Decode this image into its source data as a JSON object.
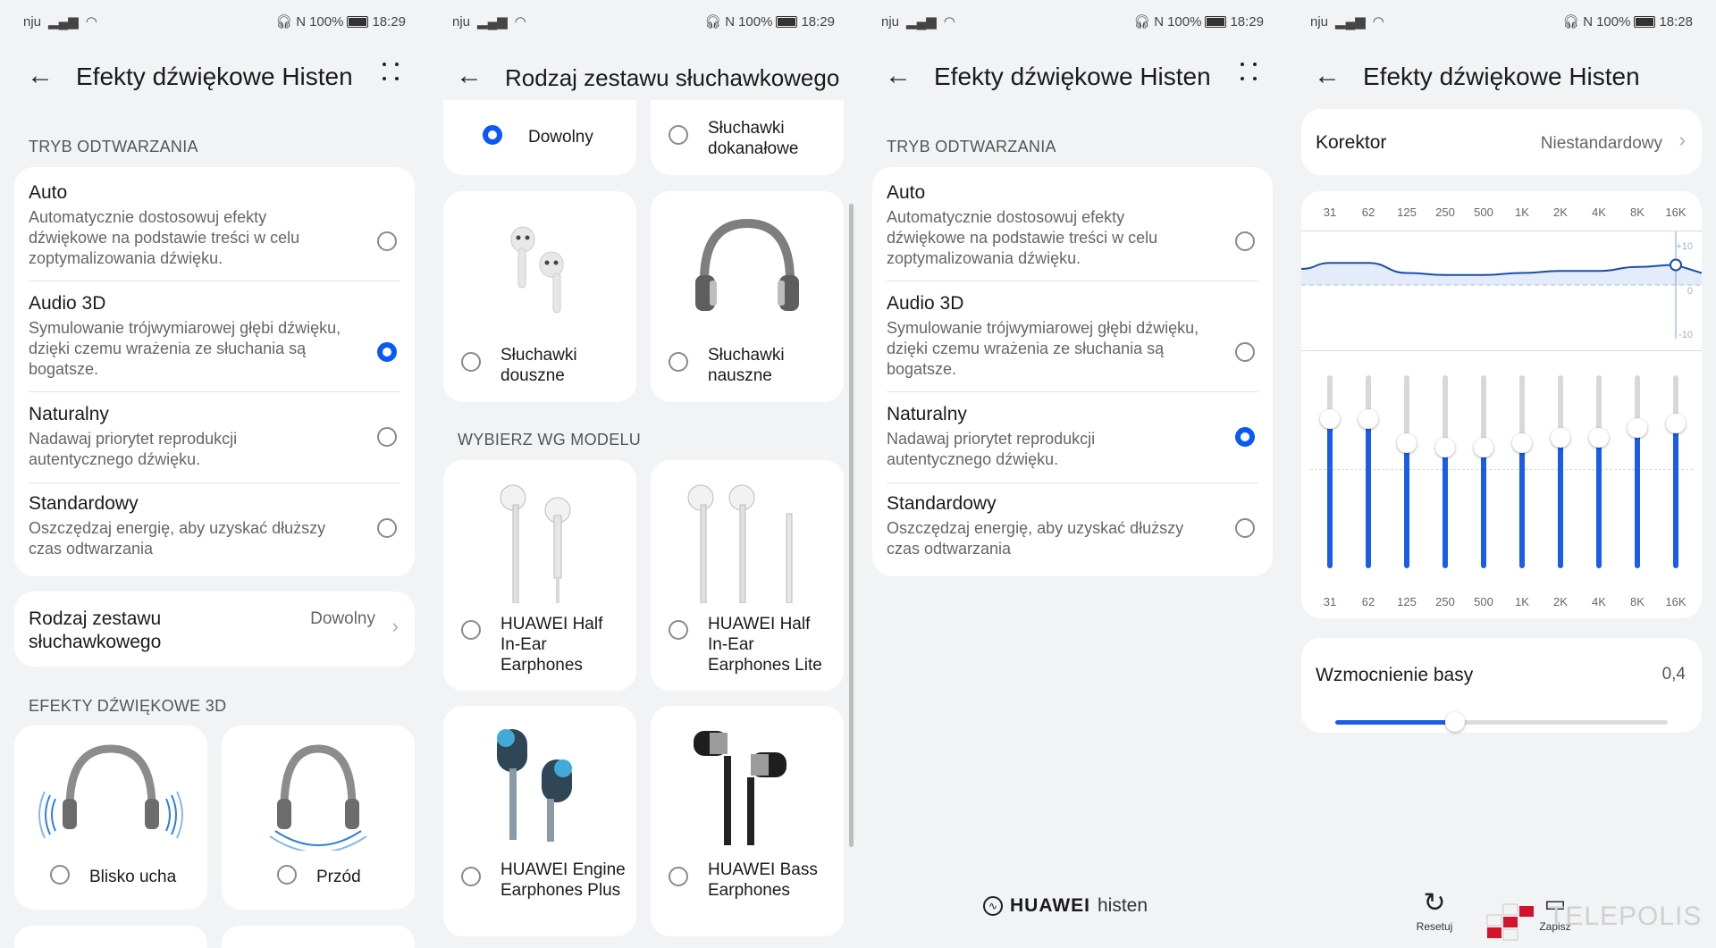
{
  "status": {
    "p1": {
      "carrier": "nju",
      "battery": "100%",
      "time": "18:29"
    },
    "p2": {
      "carrier": "nju",
      "battery": "100%",
      "time": "18:29"
    },
    "p3": {
      "carrier": "nju",
      "battery": "100%",
      "time": "18:29"
    },
    "p4": {
      "carrier": "nju",
      "battery": "100%",
      "time": "18:28"
    }
  },
  "panel1": {
    "title": "Efekty dźwiękowe Histen",
    "section_mode": "TRYB ODTWARZANIA",
    "options": [
      {
        "title": "Auto",
        "desc": "Automatycznie dostosowuj efekty dźwiękowe na podstawie treści w celu zoptymalizowania dźwięku.",
        "selected": false
      },
      {
        "title": "Audio 3D",
        "desc": "Symulowanie trójwymiarowej głębi dźwięku, dzięki czemu wrażenia ze słuchania są bogatsze.",
        "selected": true
      },
      {
        "title": "Naturalny",
        "desc": "Nadawaj priorytet reprodukcji autentycznego dźwięku.",
        "selected": false
      },
      {
        "title": "Standardowy",
        "desc": "Oszczędzaj energię, aby uzyskać dłuższy czas odtwarzania",
        "selected": false
      }
    ],
    "headset_row": {
      "label": "Rodzaj zestawu słuchawkowego",
      "value": "Dowolny"
    },
    "section_3d": "EFEKTY DŹWIĘKOWE 3D",
    "effects": [
      {
        "label": "Blisko ucha"
      },
      {
        "label": "Przód"
      }
    ]
  },
  "panel2": {
    "title": "Rodzaj zestawu słuchawkowego",
    "types": [
      {
        "label": "Dowolny",
        "selected": true
      },
      {
        "label": "Słuchawki dokanałowe",
        "selected": false
      },
      {
        "label": "Słuchawki douszne",
        "selected": false
      },
      {
        "label": "Słuchawki nauszne",
        "selected": false
      }
    ],
    "section_model": "WYBIERZ WG MODELU",
    "models": [
      {
        "label": "HUAWEI Half In-Ear Earphones"
      },
      {
        "label": "HUAWEI Half In-Ear Earphones Lite"
      },
      {
        "label": "HUAWEI Engine Earphones Plus"
      },
      {
        "label": "HUAWEI Bass Earphones"
      }
    ]
  },
  "panel3": {
    "title": "Efekty dźwiękowe Histen",
    "section_mode": "TRYB ODTWARZANIA",
    "options": [
      {
        "title": "Auto",
        "desc": "Automatycznie dostosowuj efekty dźwiękowe na podstawie treści w celu zoptymalizowania dźwięku.",
        "selected": false
      },
      {
        "title": "Audio 3D",
        "desc": "Symulowanie trójwymiarowej głębi dźwięku, dzięki czemu wrażenia ze słuchania są bogatsze.",
        "selected": false
      },
      {
        "title": "Naturalny",
        "desc": "Nadawaj priorytet reprodukcji autentycznego dźwięku.",
        "selected": true
      },
      {
        "title": "Standardowy",
        "desc": "Oszczędzaj energię, aby uzyskać dłuższy czas odtwarzania",
        "selected": false
      }
    ],
    "brand": "HUAWEI",
    "brand_suffix": "histen"
  },
  "panel4": {
    "title": "Efekty dźwiękowe Histen",
    "equalizer_label": "Korektor",
    "equalizer_value": "Niestandardowy",
    "bands": [
      "31",
      "62",
      "125",
      "250",
      "500",
      "1K",
      "2K",
      "4K",
      "8K",
      "16K"
    ],
    "band_levels_db": [
      5.5,
      5.5,
      3,
      2.5,
      2.5,
      3,
      3.5,
      3.5,
      4.5,
      5
    ],
    "scale": {
      "top": "+10",
      "mid": "0",
      "bottom": "-10"
    },
    "bass_label": "Wzmocnienie basy",
    "bass_value": "0,4",
    "bass_fraction": 0.36,
    "reset_label": "Resetuj",
    "save_label": "Zapisz",
    "watermark": "TELEPOLIS"
  }
}
